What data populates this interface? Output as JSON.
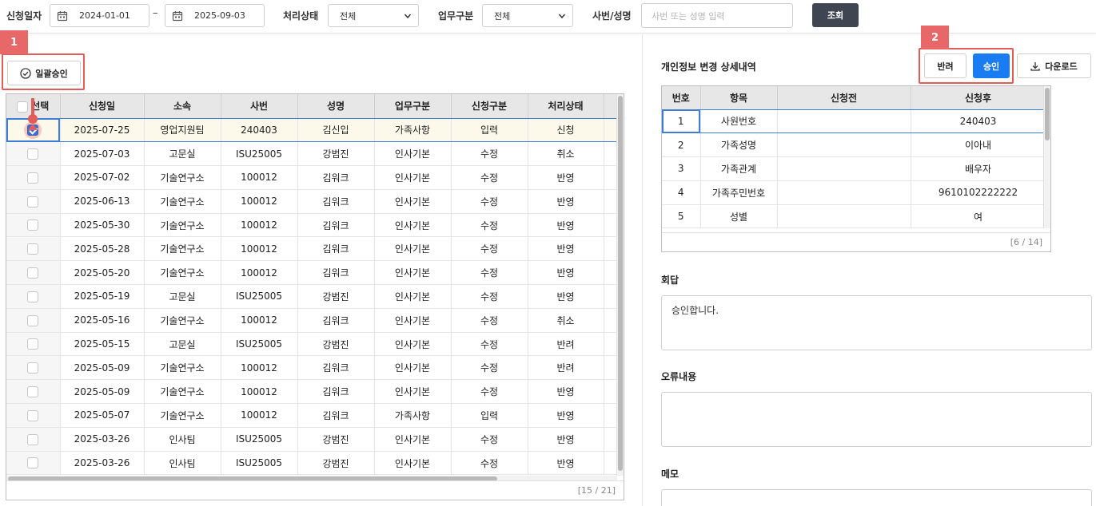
{
  "search": {
    "date_label": "신청일자",
    "date_from": "2024-01-01",
    "date_sep": "–",
    "date_to": "2025-09-03",
    "status_label": "처리상태",
    "status_value": "전체",
    "work_label": "업무구분",
    "work_value": "전체",
    "emp_label": "사번/성명",
    "emp_placeholder": "사번 또는 성명 입력",
    "search_button": "조회"
  },
  "list": {
    "bulk_approve_label": "일괄승인",
    "columns": [
      "선택",
      "신청일",
      "소속",
      "사번",
      "성명",
      "업무구분",
      "신청구분",
      "처리상태"
    ],
    "rows": [
      {
        "checked": true,
        "date": "2025-07-25",
        "dept": "영업지원팀",
        "emp_no": "240403",
        "name": "김신입",
        "work": "가족사항",
        "type": "입력",
        "status": "신청"
      },
      {
        "checked": false,
        "date": "2025-07-03",
        "dept": "고문실",
        "emp_no": "ISU25005",
        "name": "강범진",
        "work": "인사기본",
        "type": "수정",
        "status": "취소"
      },
      {
        "checked": false,
        "date": "2025-07-02",
        "dept": "기술연구소",
        "emp_no": "100012",
        "name": "김워크",
        "work": "인사기본",
        "type": "수정",
        "status": "반영"
      },
      {
        "checked": false,
        "date": "2025-06-13",
        "dept": "기술연구소",
        "emp_no": "100012",
        "name": "김워크",
        "work": "인사기본",
        "type": "수정",
        "status": "반영"
      },
      {
        "checked": false,
        "date": "2025-05-30",
        "dept": "기술연구소",
        "emp_no": "100012",
        "name": "김워크",
        "work": "인사기본",
        "type": "수정",
        "status": "반영"
      },
      {
        "checked": false,
        "date": "2025-05-28",
        "dept": "기술연구소",
        "emp_no": "100012",
        "name": "김워크",
        "work": "인사기본",
        "type": "수정",
        "status": "반영"
      },
      {
        "checked": false,
        "date": "2025-05-20",
        "dept": "기술연구소",
        "emp_no": "100012",
        "name": "김워크",
        "work": "인사기본",
        "type": "수정",
        "status": "반영"
      },
      {
        "checked": false,
        "date": "2025-05-19",
        "dept": "고문실",
        "emp_no": "ISU25005",
        "name": "강범진",
        "work": "인사기본",
        "type": "수정",
        "status": "반영"
      },
      {
        "checked": false,
        "date": "2025-05-16",
        "dept": "기술연구소",
        "emp_no": "100012",
        "name": "김워크",
        "work": "인사기본",
        "type": "수정",
        "status": "취소"
      },
      {
        "checked": false,
        "date": "2025-05-15",
        "dept": "고문실",
        "emp_no": "ISU25005",
        "name": "강범진",
        "work": "인사기본",
        "type": "수정",
        "status": "반려"
      },
      {
        "checked": false,
        "date": "2025-05-09",
        "dept": "기술연구소",
        "emp_no": "100012",
        "name": "김워크",
        "work": "인사기본",
        "type": "수정",
        "status": "반려"
      },
      {
        "checked": false,
        "date": "2025-05-09",
        "dept": "기술연구소",
        "emp_no": "100012",
        "name": "김워크",
        "work": "인사기본",
        "type": "수정",
        "status": "반영"
      },
      {
        "checked": false,
        "date": "2025-05-07",
        "dept": "기술연구소",
        "emp_no": "100012",
        "name": "김워크",
        "work": "가족사항",
        "type": "입력",
        "status": "반영"
      },
      {
        "checked": false,
        "date": "2025-03-26",
        "dept": "인사팀",
        "emp_no": "ISU25005",
        "name": "강범진",
        "work": "인사기본",
        "type": "수정",
        "status": "반영"
      },
      {
        "checked": false,
        "date": "2025-03-26",
        "dept": "인사팀",
        "emp_no": "ISU25005",
        "name": "강범진",
        "work": "인사기본",
        "type": "수정",
        "status": "반영"
      }
    ],
    "footer": "[15 / 21]"
  },
  "annotations": {
    "marker1": "1",
    "marker2": "2"
  },
  "detail": {
    "title": "개인정보 변경 상세내역",
    "reject_button": "반려",
    "approve_button": "승인",
    "download_button": "다운로드",
    "columns": [
      "번호",
      "항목",
      "신청전",
      "신청후"
    ],
    "rows": [
      {
        "no": "1",
        "item": "사원번호",
        "before": "",
        "after": "240403"
      },
      {
        "no": "2",
        "item": "가족성명",
        "before": "",
        "after": "이아내"
      },
      {
        "no": "3",
        "item": "가족관계",
        "before": "",
        "after": "배우자"
      },
      {
        "no": "4",
        "item": "가족주민번호",
        "before": "",
        "after": "9610102222222"
      },
      {
        "no": "5",
        "item": "성별",
        "before": "",
        "after": "여"
      }
    ],
    "footer": "[6 / 14]"
  },
  "reply": {
    "label": "회답",
    "value": "승인합니다."
  },
  "error": {
    "label": "오류내용",
    "value": ""
  },
  "memo": {
    "label": "메모",
    "value": ""
  },
  "colors": {
    "primary": "#1a7cf2",
    "search_button": "#3f4652",
    "annotation": "#e8686a",
    "selected_row": "#fdf9ea",
    "focus": "#3d7fd6"
  }
}
